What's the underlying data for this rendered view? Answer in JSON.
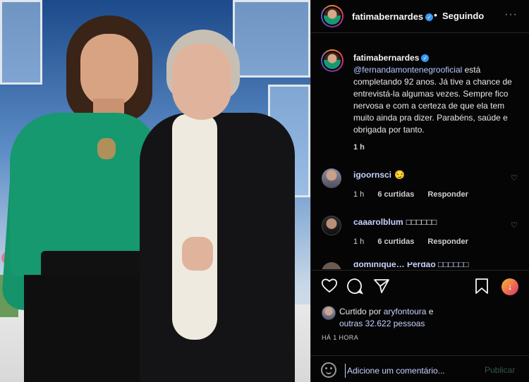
{
  "post": {
    "author": "fatimabernardes",
    "follow_status": "Seguindo",
    "more_icon": "more-dots-icon"
  },
  "caption": {
    "author": "fatimabernardes",
    "mention": "@fernandamontenegrooficial",
    "text": " está completando 92 anos. Já tive a chance de entrevistá-la algumas vezes. Sempre fico nervosa e com a certeza de que ela tem muito ainda pra dizer. Parabéns, saúde e obrigada por tanto.",
    "time": "1 h"
  },
  "comments": [
    {
      "user": "igoornsci",
      "text": "😏",
      "time": "1 h",
      "likes": "6 curtidas",
      "reply": "Responder"
    },
    {
      "user": "caaarolblum",
      "text": "□□□□□□",
      "time": "1 h",
      "likes": "6 curtidas",
      "reply": "Responder"
    }
  ],
  "partial_comment": "dominique… Perdão □□□□□□",
  "likes": {
    "prefix": "Curtido por",
    "first_user": "aryfontoura",
    "conj": "e",
    "others": "outras 32.622 pessoas"
  },
  "time_ago": "HÁ 1 HORA",
  "add_comment": {
    "placeholder": "Adicione um comentário...",
    "publish_label": "Publicar"
  },
  "colors": {
    "verified": "#3897f0",
    "link": "#c8d2ff",
    "publish_disabled": "#2f5a44"
  }
}
